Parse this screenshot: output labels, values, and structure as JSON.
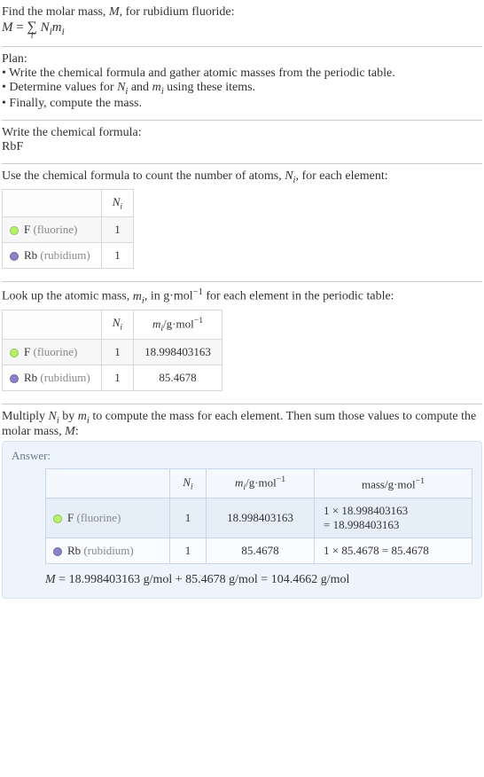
{
  "intro": {
    "line1_a": "Find the molar mass, ",
    "line1_M": "M",
    "line1_b": ", for rubidium fluoride:",
    "eq_M": "M",
    "eq_eq": " = ",
    "eq_sum": "∑",
    "eq_idx": "i",
    "eq_Ni": "N",
    "eq_i1": "i",
    "eq_mi": "m",
    "eq_i2": "i"
  },
  "plan": {
    "header": "Plan:",
    "line1": "• Write the chemical formula and gather atomic masses from the periodic table.",
    "line2_a": "• Determine values for ",
    "line2_N": "N",
    "line2_i1": "i",
    "line2_b": " and ",
    "line2_m": "m",
    "line2_i2": "i",
    "line2_c": " using these items.",
    "line3": "• Finally, compute the mass."
  },
  "formula": {
    "header": "Write the chemical formula:",
    "value": "RbF"
  },
  "count": {
    "header_a": "Use the chemical formula to count the number of atoms, ",
    "header_N": "N",
    "header_i": "i",
    "header_b": ", for each element:",
    "col_N": "N",
    "col_Ni": "i",
    "f_label": "F",
    "f_name": " (fluorine)",
    "f_count": "1",
    "rb_label": "Rb",
    "rb_name": " (rubidium)",
    "rb_count": "1"
  },
  "mass": {
    "header_a": "Look up the atomic mass, ",
    "header_m": "m",
    "header_i": "i",
    "header_b": ", in g·mol",
    "header_exp": "−1",
    "header_c": " for each element in the periodic table:",
    "col_N": "N",
    "col_Ni": "i",
    "col_m": "m",
    "col_mi": "i",
    "col_unit": "/g·mol",
    "col_exp": "−1",
    "f_label": "F",
    "f_name": " (fluorine)",
    "f_count": "1",
    "f_mass": "18.998403163",
    "rb_label": "Rb",
    "rb_name": " (rubidium)",
    "rb_count": "1",
    "rb_mass": "85.4678"
  },
  "compute": {
    "line_a": "Multiply ",
    "line_N": "N",
    "line_i1": "i",
    "line_b": " by ",
    "line_m": "m",
    "line_i2": "i",
    "line_c": " to compute the mass for each element. Then sum those values to compute the molar mass, ",
    "line_M": "M",
    "line_d": ":"
  },
  "answer": {
    "label": "Answer:",
    "col_N": "N",
    "col_Ni": "i",
    "col_m": "m",
    "col_mi": "i",
    "col_unit": "/g·mol",
    "col_exp": "−1",
    "col_mass": "mass/g·mol",
    "col_mass_exp": "−1",
    "f_label": "F",
    "f_name": " (fluorine)",
    "f_count": "1",
    "f_mass": "18.998403163",
    "f_calc1": "1 × 18.998403163",
    "f_calc2": "= 18.998403163",
    "rb_label": "Rb",
    "rb_name": " (rubidium)",
    "rb_count": "1",
    "rb_mass": "85.4678",
    "rb_calc": "1 × 85.4678 = 85.4678",
    "final_M": "M",
    "final_eq": " = 18.998403163 g/mol + 85.4678 g/mol = 104.4662 g/mol"
  }
}
